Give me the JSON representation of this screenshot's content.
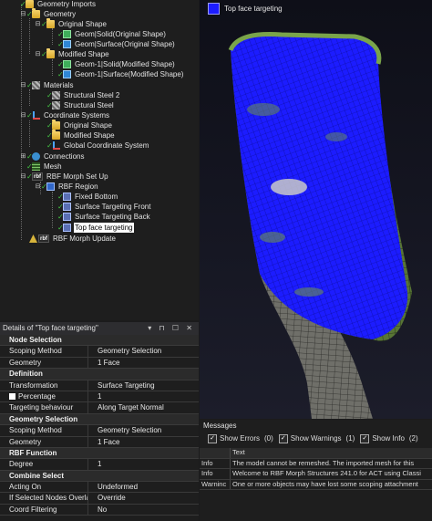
{
  "tree": {
    "items": [
      {
        "label": "Geometry Imports"
      },
      {
        "label": "Geometry"
      },
      {
        "label": "Original Shape"
      },
      {
        "label": "Geom|Solid(Original Shape)"
      },
      {
        "label": "Geom|Surface(Original Shape)"
      },
      {
        "label": "Modified Shape"
      },
      {
        "label": "Geom-1|Solid(Modified Shape)"
      },
      {
        "label": "Geom-1|Surface(Modified Shape)"
      },
      {
        "label": "Materials"
      },
      {
        "label": "Structural Steel 2"
      },
      {
        "label": "Structural Steel"
      },
      {
        "label": "Coordinate Systems"
      },
      {
        "label": "Original Shape"
      },
      {
        "label": "Modified Shape"
      },
      {
        "label": "Global Coordinate System"
      },
      {
        "label": "Connections"
      },
      {
        "label": "Mesh"
      },
      {
        "label": "RBF Morph Set Up"
      },
      {
        "label": "RBF Region"
      },
      {
        "label": "Fixed Bottom"
      },
      {
        "label": "Surface Targeting Front"
      },
      {
        "label": "Surface Targeting Back"
      },
      {
        "label": "Top face targeting"
      },
      {
        "label": "RBF Morph Update"
      }
    ],
    "icons": {
      "rbf": "rbf"
    }
  },
  "details": {
    "title": "Details of \"Top face targeting\"",
    "tools": "▾ ⊓ ☐ ✕",
    "sections": [
      {
        "title": "Node Selection",
        "rows": [
          {
            "k": "Scoping Method",
            "v": "Geometry Selection"
          },
          {
            "k": "Geometry",
            "v": "1 Face"
          }
        ]
      },
      {
        "title": "Definition",
        "rows": [
          {
            "k": "Transformation",
            "v": "Surface Targeting"
          },
          {
            "k": "Percentage",
            "v": "1"
          },
          {
            "k": "Targeting behaviour",
            "v": "Along Target Normal"
          }
        ]
      },
      {
        "title": "Geometry Selection",
        "rows": [
          {
            "k": "Scoping Method",
            "v": "Geometry Selection"
          },
          {
            "k": "Geometry",
            "v": "1 Face"
          }
        ]
      },
      {
        "title": "RBF Function",
        "rows": [
          {
            "k": "Degree",
            "v": "1"
          }
        ]
      },
      {
        "title": "Combine Select",
        "rows": [
          {
            "k": "Acting On",
            "v": "Undeformed"
          },
          {
            "k": "If Selected Nodes Overlap",
            "v": "Override"
          },
          {
            "k": "Coord Filtering",
            "v": "No"
          }
        ]
      }
    ]
  },
  "viewport": {
    "legend_label": "Top face targeting",
    "colors": {
      "target": "#1c1cff",
      "mesh": "#5e7a3a",
      "steel": "#70706a"
    }
  },
  "messages": {
    "title": "Messages",
    "filters": [
      {
        "label": "Show Errors",
        "count": "(0)"
      },
      {
        "label": "Show Warnings",
        "count": "(1)"
      },
      {
        "label": "Show Info",
        "count": "(2)"
      }
    ],
    "header": "Text",
    "rows": [
      {
        "type": "Info",
        "text": "The model cannot be remeshed. The imported mesh for this"
      },
      {
        "type": "Info",
        "text": "Welcome to RBF Morph Structures 241.0 for ACT using Classi"
      },
      {
        "type": "Warninc",
        "text": "One or more objects may have lost some scoping attachment"
      }
    ]
  }
}
